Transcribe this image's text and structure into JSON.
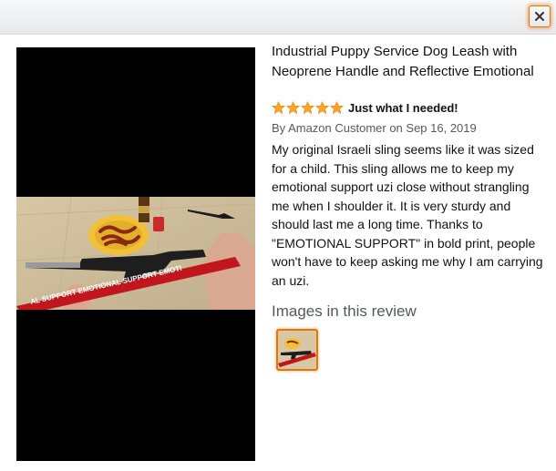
{
  "modal": {
    "close_icon": "close-icon"
  },
  "product": {
    "title": "Industrial Puppy Service Dog Leash with Neoprene Handle and Reflective Emotional"
  },
  "review": {
    "rating": 5,
    "rating_max": 5,
    "star_color": "#ffa41c",
    "title": "Just what I needed!",
    "byline": "By Amazon Customer on Sep 16, 2019",
    "body": "My original Israeli sling seems like it was sized for a child. This sling allows me to keep my emotional support uzi close without strangling me when I shoulder it. It is very sturdy and should last me a long time. Thanks to \"EMOTIONAL SUPPORT\" in bold print, people won't have to keep asking me why I am carrying an uzi."
  },
  "images_section": {
    "heading": "Images in this review"
  },
  "photo": {
    "strap_text": "AL SUPPORT EMOTIONAL SUPPORT EMOTI"
  },
  "colors": {
    "accent_orange": "#e77600",
    "strap_red": "#c0161c"
  }
}
